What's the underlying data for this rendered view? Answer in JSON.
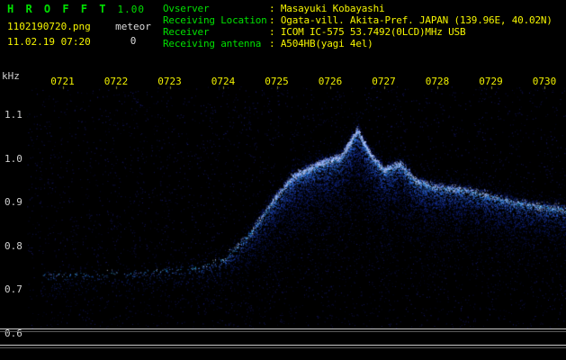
{
  "app": {
    "title": "H R O F F T",
    "version": "1.00",
    "filename": "1102190720.png",
    "mode_label": "meteor",
    "meteor_count": "0",
    "timestamp": "11.02.19 07:20"
  },
  "info": {
    "rows": [
      {
        "label": "Ovserver",
        "value": ": Masayuki Kobayashi"
      },
      {
        "label": "Receiving Location",
        "value": ": Ogata-vill. Akita-Pref. JAPAN (139.96E, 40.02N)"
      },
      {
        "label": "Receiver",
        "value": ": ICOM IC-575 53.7492(0LCD)MHz USB"
      },
      {
        "label": "Receiving antenna",
        "value": ": A504HB(yagi 4el)"
      }
    ]
  },
  "colors": {
    "label_green": "#00e000",
    "value_yellow": "#f5f500",
    "axis_text": "#d0d0d0",
    "noise_blue": "#3c3cff",
    "background": "#000000"
  },
  "chart_data": {
    "type": "heatmap",
    "title": "HROFFT radio meteor spectrogram 0720-0730",
    "ylabel": "kHz",
    "y_unit": "kHz",
    "x_ticklabels": [
      "0721",
      "0722",
      "0723",
      "0724",
      "0725",
      "0726",
      "0727",
      "0728",
      "0729",
      "0730"
    ],
    "y_ticklabels": [
      "1.1",
      "1.0",
      "0.9",
      "0.8",
      "0.7",
      "0.6"
    ],
    "y_range_khz": [
      0.6,
      1.17
    ],
    "x_range_minutes_after_0720": [
      0.3,
      10.4
    ],
    "grid": false,
    "legend": false,
    "ridge_description": "Broad blue noise band rising from ~0.75 kHz around 0724 to a peak of ~1.07 kHz near 0726.5, then sloping down to ~0.89 kHz at 0730; faint scattered noise elsewhere.",
    "ridge": [
      {
        "t": 0.6,
        "khz": 0.735,
        "i": 0.05
      },
      {
        "t": 2.2,
        "khz": 0.74,
        "i": 0.05
      },
      {
        "t": 3.4,
        "khz": 0.75,
        "i": 0.1
      },
      {
        "t": 4.0,
        "khz": 0.77,
        "i": 0.18
      },
      {
        "t": 4.5,
        "khz": 0.83,
        "i": 0.4
      },
      {
        "t": 4.9,
        "khz": 0.9,
        "i": 0.75
      },
      {
        "t": 5.3,
        "khz": 0.96,
        "i": 0.95
      },
      {
        "t": 5.8,
        "khz": 0.99,
        "i": 1.0
      },
      {
        "t": 6.2,
        "khz": 1.005,
        "i": 1.0
      },
      {
        "t": 6.5,
        "khz": 1.065,
        "i": 1.0
      },
      {
        "t": 6.75,
        "khz": 1.01,
        "i": 0.95
      },
      {
        "t": 7.0,
        "khz": 0.975,
        "i": 0.9
      },
      {
        "t": 7.3,
        "khz": 0.99,
        "i": 0.85
      },
      {
        "t": 7.6,
        "khz": 0.95,
        "i": 0.8
      },
      {
        "t": 8.0,
        "khz": 0.935,
        "i": 0.7
      },
      {
        "t": 8.5,
        "khz": 0.93,
        "i": 0.65
      },
      {
        "t": 9.0,
        "khz": 0.915,
        "i": 0.6
      },
      {
        "t": 9.5,
        "khz": 0.9,
        "i": 0.55
      },
      {
        "t": 10.05,
        "khz": 0.89,
        "i": 0.5
      },
      {
        "t": 10.4,
        "khz": 0.885,
        "i": 0.5
      }
    ]
  }
}
